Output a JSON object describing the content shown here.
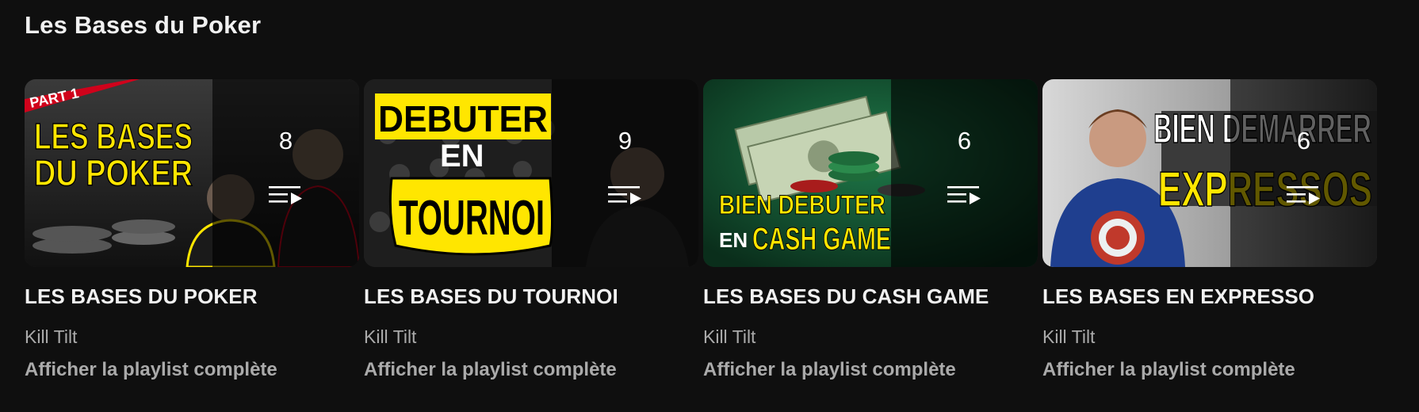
{
  "shelf": {
    "title": "Les Bases du Poker"
  },
  "playlists": [
    {
      "title": "LES BASES DU POKER",
      "channel": "Kill Tilt",
      "view_link": "Afficher la playlist complète",
      "video_count": "8",
      "thumbnail_text": [
        "PART 1",
        "LES BASES",
        "DU POKER"
      ]
    },
    {
      "title": "LES BASES DU TOURNOI",
      "channel": "Kill Tilt",
      "view_link": "Afficher la playlist complète",
      "video_count": "9",
      "thumbnail_text": [
        "DEBUTER",
        "EN",
        "TOURNOI"
      ]
    },
    {
      "title": "LES BASES DU CASH GAME",
      "channel": "Kill Tilt",
      "view_link": "Afficher la playlist complète",
      "video_count": "6",
      "thumbnail_text": [
        "BIEN DEBUTER",
        "EN",
        "CASH GAME"
      ]
    },
    {
      "title": "LES BASES EN EXPRESSO",
      "channel": "Kill Tilt",
      "view_link": "Afficher la playlist complète",
      "video_count": "6",
      "thumbnail_text": [
        "BIEN DEMARRER",
        "EXPRESSOS"
      ]
    }
  ],
  "icons": {
    "playlist": "playlist-play-icon"
  },
  "colors": {
    "background": "#0f0f0f",
    "text_primary": "#f1f1f1",
    "text_secondary": "#aaaaaa",
    "thumbnail_yellow": "#ffe600",
    "part_ribbon_red": "#d0021b"
  }
}
